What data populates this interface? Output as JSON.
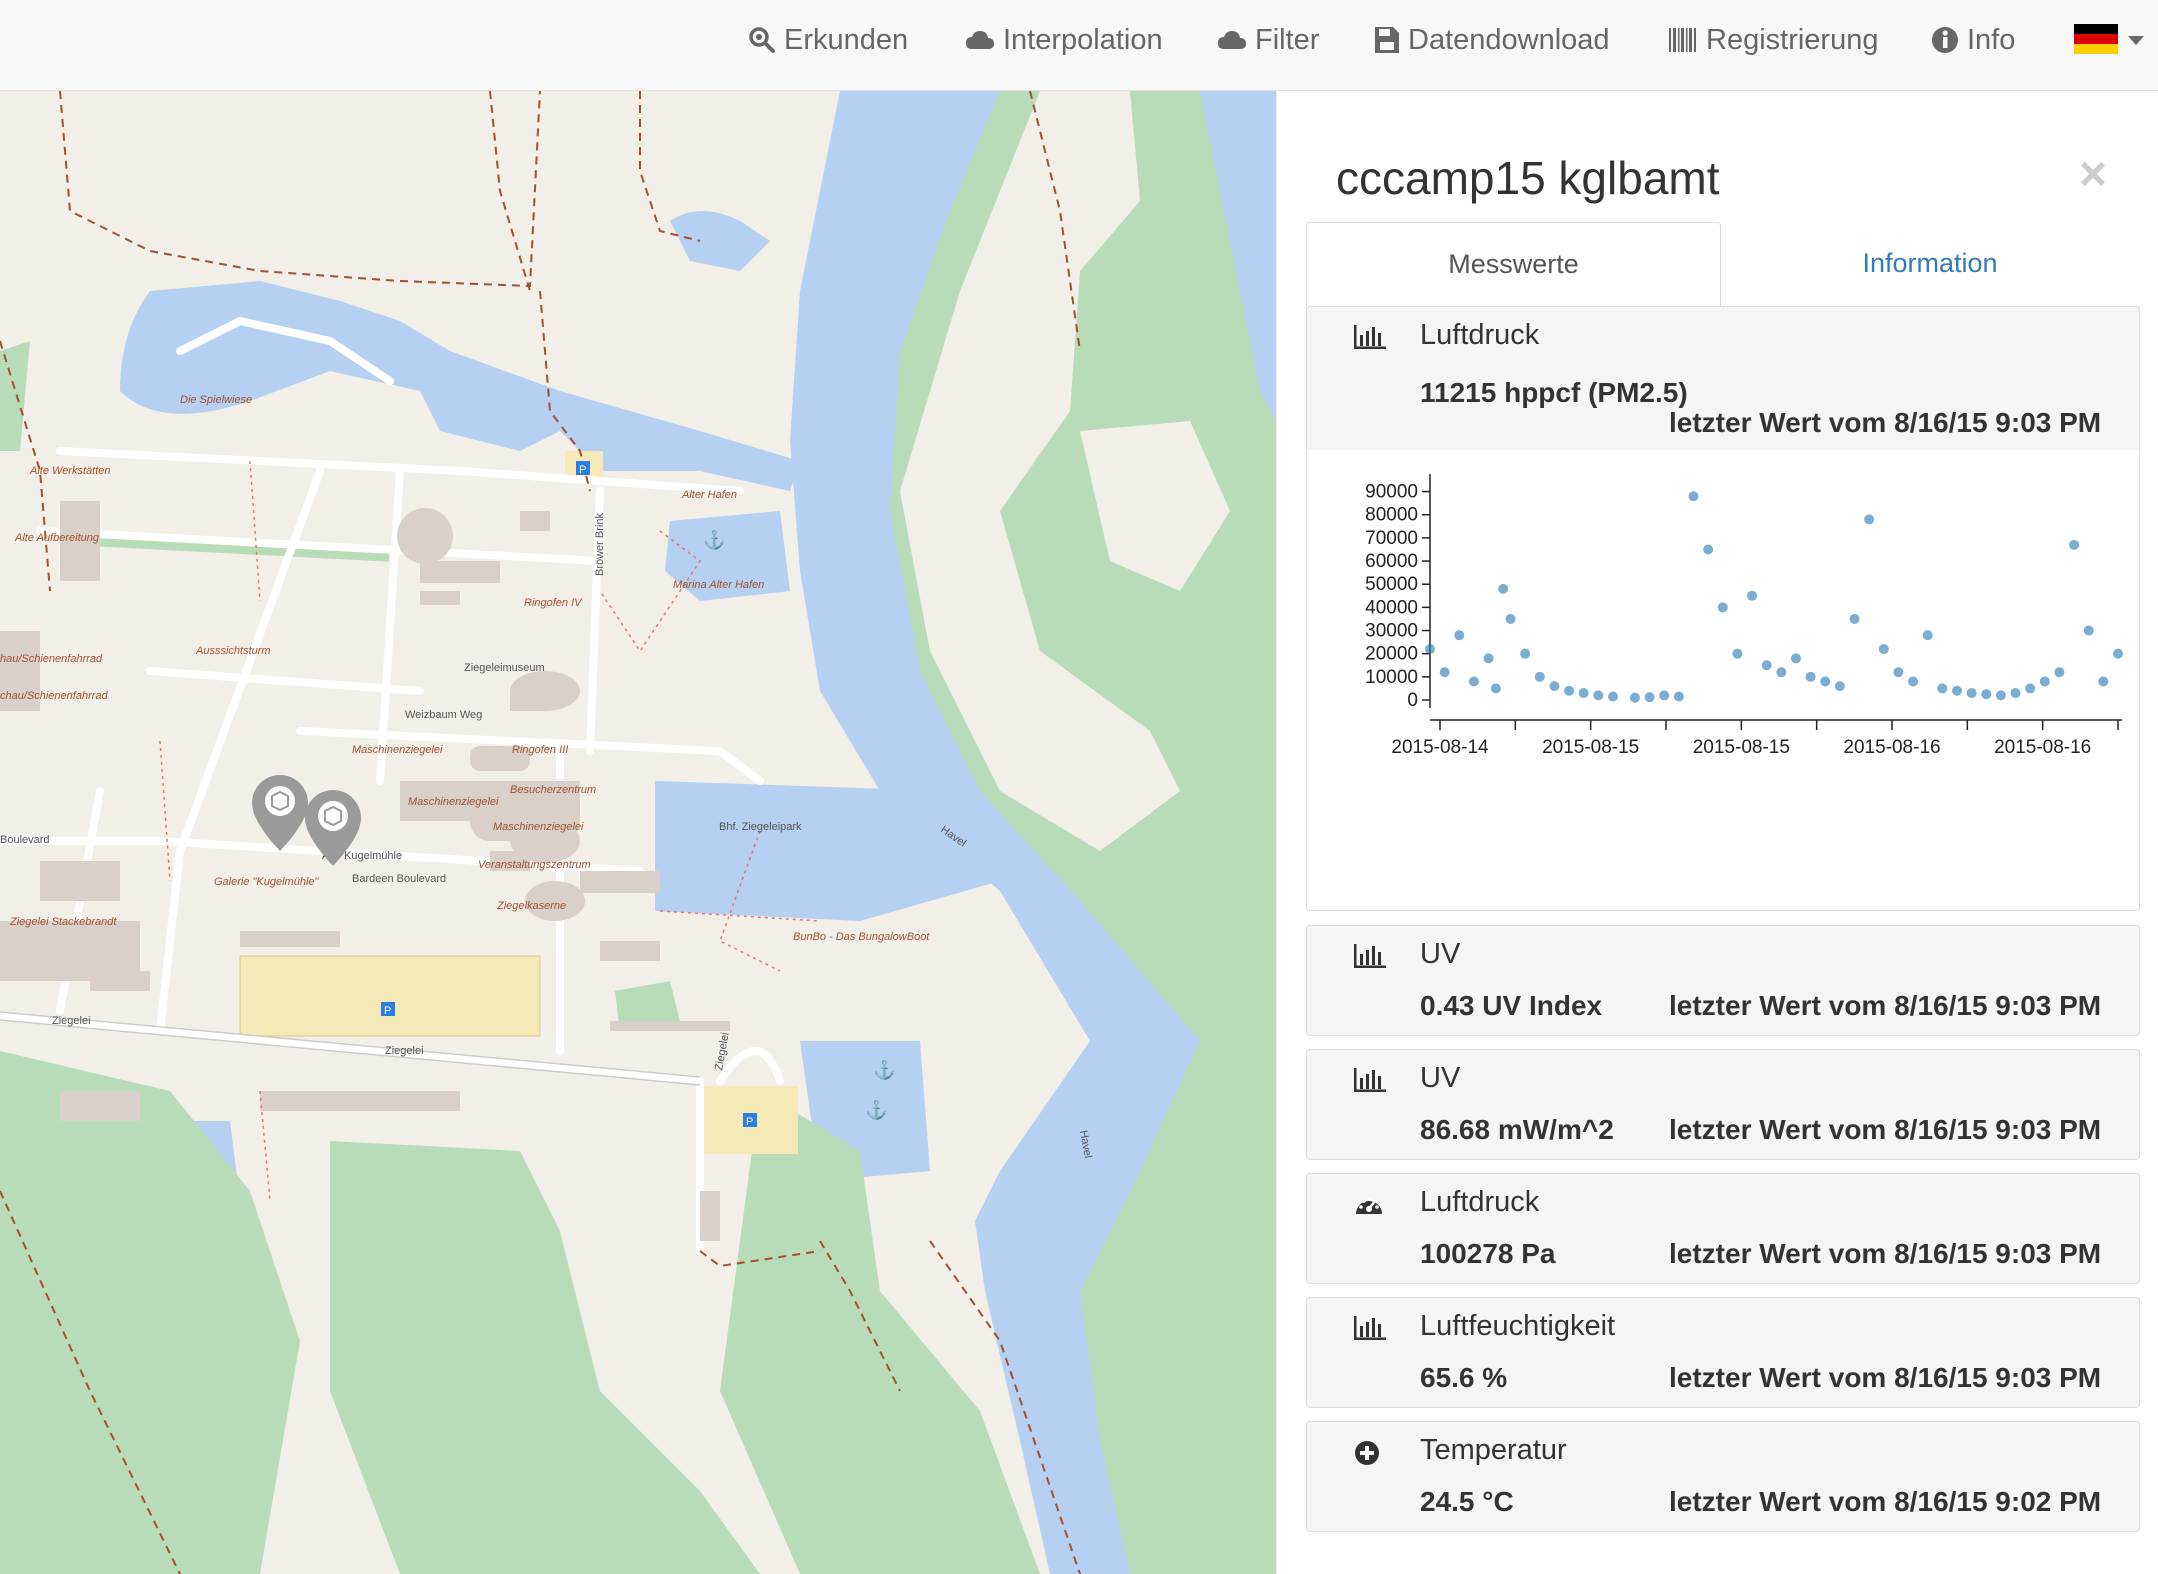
{
  "nav": {
    "items": [
      {
        "label": "Erkunden",
        "icon": "search-icon"
      },
      {
        "label": "Interpolation",
        "icon": "cloud-icon"
      },
      {
        "label": "Filter",
        "icon": "cloud-icon"
      },
      {
        "label": "Datendownload",
        "icon": "save-icon"
      },
      {
        "label": "Registrierung",
        "icon": "barcode-icon"
      },
      {
        "label": "Info",
        "icon": "info-icon"
      }
    ],
    "language": "german-flag-icon"
  },
  "map": {
    "labels": [
      "Die Spielwiese",
      "Alte Werkstätten",
      "Alte Aufbereitung",
      "Ausssichtsturm",
      "hau/Schienenfahrrad",
      "chau/Schienenfahrrad",
      "Ringofen IV",
      "Ziegeleimuseum",
      "Weizbaum Weg",
      "Maschinenziegelei",
      "Ringofen III",
      "Besucherzentrum",
      "Maschinenziegelei",
      "Maschinenziegelei",
      "Veranstaltungszentrum",
      "Ziegelkaserne",
      "Alte Kugelmühle",
      "Bardeen Boulevard",
      "Galerie \"Kugelmühle\"",
      "Ziegelei Stackebrandt",
      "Ziegelei",
      "Ziegelei",
      "Ziegelei",
      "Alter Hafen",
      "Marina Alter Hafen",
      "Bröwer Brink",
      "Bhf. Ziegeleipark",
      "Havel",
      "Havel",
      "BunBo - Das BungalowBoot",
      "Boulevard"
    ]
  },
  "panel": {
    "title": "cccamp15 kglbamt",
    "close": "×",
    "tabs": {
      "active": "Messwerte",
      "inactive": "Information"
    },
    "sensors": [
      {
        "icon": "bar-chart-icon",
        "name": "Luftdruck",
        "value": "11215 hppcf (PM2.5)",
        "last": "letzter Wert vom 8/16/15 9:03 PM"
      },
      {
        "icon": "bar-chart-icon",
        "name": "UV",
        "value": "0.43 UV Index",
        "last": "letzter Wert vom 8/16/15 9:03 PM"
      },
      {
        "icon": "bar-chart-icon",
        "name": "UV",
        "value": "86.68 mW/m^2",
        "last": "letzter Wert vom 8/16/15 9:03 PM"
      },
      {
        "icon": "dashboard-icon",
        "name": "Luftdruck",
        "value": "100278 Pa",
        "last": "letzter Wert vom 8/16/15 9:03 PM"
      },
      {
        "icon": "bar-chart-icon",
        "name": "Luftfeuchtigkeit",
        "value": "65.6 %",
        "last": "letzter Wert vom 8/16/15 9:03 PM"
      },
      {
        "icon": "plus-circle-icon",
        "name": "Temperatur",
        "value": "24.5 °C",
        "last": "letzter Wert vom 8/16/15 9:02 PM"
      }
    ]
  },
  "colors": {
    "accent": "#337ab7",
    "point": "#1f77b4",
    "water": "#b5d0f0",
    "green": "#b9dcb8"
  },
  "chart_data": {
    "type": "scatter",
    "ylim": [
      0,
      95000
    ],
    "y_ticks": [
      0,
      10000,
      20000,
      30000,
      40000,
      50000,
      60000,
      70000,
      80000,
      90000
    ],
    "x_ticks": [
      "2015-08-14",
      "2015-08-15",
      "2015-08-15",
      "2015-08-16",
      "2015-08-16"
    ],
    "x": [
      0,
      0.2,
      0.4,
      0.6,
      0.8,
      0.9,
      1.0,
      1.1,
      1.3,
      1.5,
      1.7,
      1.9,
      2.1,
      2.3,
      2.5,
      2.8,
      3.0,
      3.2,
      3.4,
      3.6,
      3.8,
      4.0,
      4.2,
      4.4,
      4.6,
      4.8,
      5.0,
      5.2,
      5.4,
      5.6,
      5.8,
      6.0,
      6.2,
      6.4,
      6.6,
      6.8,
      7.0,
      7.2,
      7.4,
      7.6,
      7.8,
      8.0,
      8.2,
      8.4,
      8.6,
      8.8,
      9.0,
      9.2,
      9.4
    ],
    "values": [
      22000,
      12000,
      28000,
      8000,
      18000,
      5000,
      48000,
      35000,
      20000,
      10000,
      6000,
      4000,
      3000,
      2000,
      1500,
      1000,
      1200,
      2000,
      1500,
      88000,
      65000,
      40000,
      20000,
      45000,
      15000,
      12000,
      18000,
      10000,
      8000,
      6000,
      35000,
      78000,
      22000,
      12000,
      8000,
      28000,
      5000,
      4000,
      3000,
      2500,
      2000,
      3000,
      5000,
      8000,
      12000,
      67000,
      30000,
      8000,
      20000
    ]
  }
}
